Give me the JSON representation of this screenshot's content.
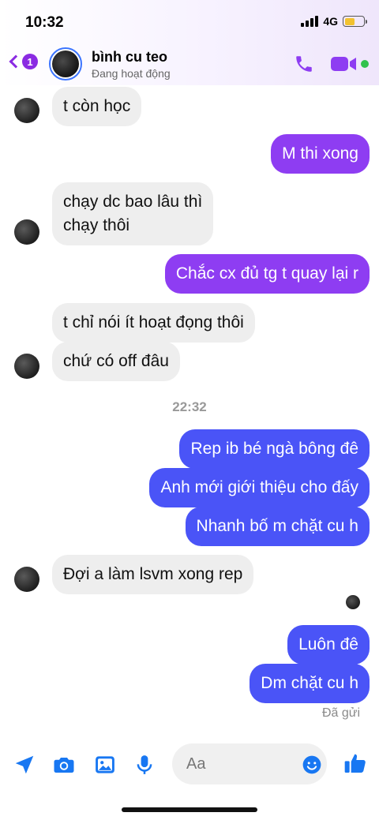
{
  "status_bar": {
    "time": "10:32",
    "network": "4G"
  },
  "header": {
    "back_count": "1",
    "contact_name": "bình cu teo",
    "contact_status": "Đang hoạt động"
  },
  "messages": [
    {
      "side": "in",
      "text": "t còn học"
    },
    {
      "side": "out",
      "text": "M thi xong"
    },
    {
      "side": "in",
      "lines": [
        "chạy dc bao lâu thì",
        "chạy thôi"
      ]
    },
    {
      "side": "out",
      "text": "Chắc cx đủ tg t quay lại r"
    },
    {
      "side": "in",
      "text": "t chỉ nói ít hoạt đọng thôi"
    },
    {
      "side": "in",
      "text": "chứ có off đâu"
    },
    {
      "side": "out",
      "text": "Rep ib bé ngà bông đê"
    },
    {
      "side": "out",
      "text": "Anh mới giới thiệu cho đấy"
    },
    {
      "side": "out",
      "text": "Nhanh bố m chặt cu h"
    },
    {
      "side": "in",
      "text": "Đợi a làm lsvm xong rep"
    },
    {
      "side": "out",
      "text": "Luôn đê"
    },
    {
      "side": "out",
      "text": "Dm chặt cu h"
    }
  ],
  "timestamp": "22:32",
  "sent_status": "Đã gửi",
  "composer": {
    "placeholder": "Aa"
  },
  "colors": {
    "accent_purple": "#8e3df2",
    "bubble_blue": "#4a54f7",
    "incoming_bg": "#eeeeee",
    "online_green": "#31c24d",
    "icon_blue": "#1877f2"
  },
  "icons": [
    "back-chevron-icon",
    "phone-icon",
    "video-camera-icon",
    "location-arrow-icon",
    "camera-icon",
    "gallery-icon",
    "microphone-icon",
    "emoji-icon",
    "thumbs-up-icon"
  ]
}
